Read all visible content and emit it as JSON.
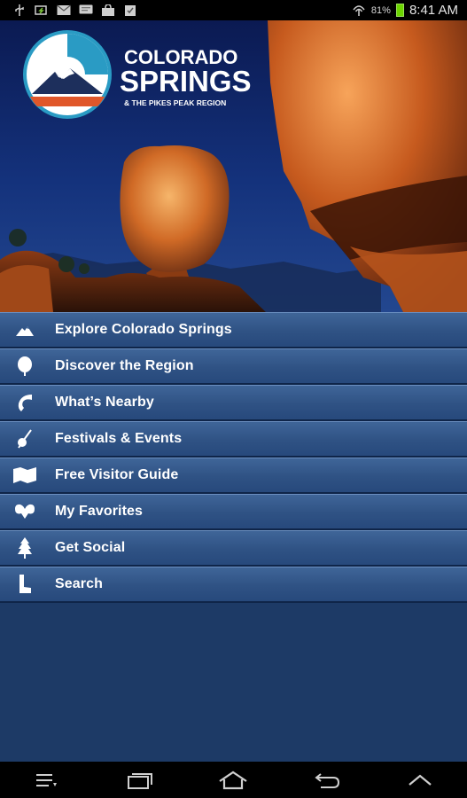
{
  "status_bar": {
    "battery_percent": "81%",
    "time": "8:41 AM",
    "icons": [
      "usb-icon",
      "charging-icon",
      "mail-icon",
      "chat-icon",
      "shopping-bag-icon",
      "checklist-icon",
      "signal-icon",
      "battery-icon"
    ]
  },
  "hero": {
    "logo": {
      "line1": "COLORADO",
      "line2": "SPRINGS",
      "line3": "& THE PIKES PEAK REGION"
    }
  },
  "menu": {
    "items": [
      {
        "label": "Explore Colorado Springs",
        "icon": "mountain-icon"
      },
      {
        "label": "Discover the Region",
        "icon": "leaf-icon"
      },
      {
        "label": "What’s Nearby",
        "icon": "compass-icon"
      },
      {
        "label": "Festivals & Events",
        "icon": "banjo-icon"
      },
      {
        "label": "Free Visitor Guide",
        "icon": "map-icon"
      },
      {
        "label": "My Favorites",
        "icon": "ram-icon"
      },
      {
        "label": "Get Social",
        "icon": "tree-icon"
      },
      {
        "label": "Search",
        "icon": "boot-icon"
      }
    ]
  },
  "nav_bar": {
    "buttons": [
      "menu-icon",
      "recent-apps-icon",
      "home-icon",
      "back-icon",
      "up-icon"
    ]
  },
  "colors": {
    "background": "#1d3a66",
    "menu_item": "#2f5284",
    "accent_orange": "#e0572a",
    "accent_teal": "#2a9bc4"
  }
}
